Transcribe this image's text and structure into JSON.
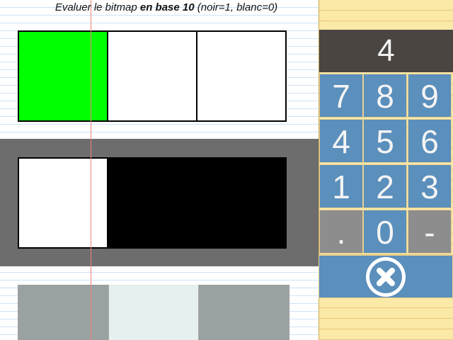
{
  "instruction": {
    "prefix": "Evaluer le bitmap ",
    "emphasis": "en base 10",
    "suffix": " (noir=1, blanc=0)"
  },
  "bitmap_rows": [
    {
      "cells": [
        "green",
        "white",
        "white"
      ],
      "state": "answered"
    },
    {
      "cells": [
        "white",
        "black",
        "black"
      ],
      "state": "active"
    },
    {
      "cells": [
        "gray",
        "white",
        "gray"
      ],
      "state": "upcoming"
    }
  ],
  "colors": {
    "green": "#00ff00",
    "white": "#ffffff",
    "black": "#000000",
    "keypad_blue": "#5b8fbc",
    "display_bg": "#4a4540"
  },
  "keypad": {
    "display_value": "4",
    "keys": [
      {
        "label": "7"
      },
      {
        "label": "8"
      },
      {
        "label": "9"
      },
      {
        "label": "4"
      },
      {
        "label": "5"
      },
      {
        "label": "6"
      },
      {
        "label": "1"
      },
      {
        "label": "2"
      },
      {
        "label": "3"
      },
      {
        "label": "."
      },
      {
        "label": "0"
      },
      {
        "label": "-"
      }
    ],
    "clear_icon": "close-circle-icon"
  }
}
